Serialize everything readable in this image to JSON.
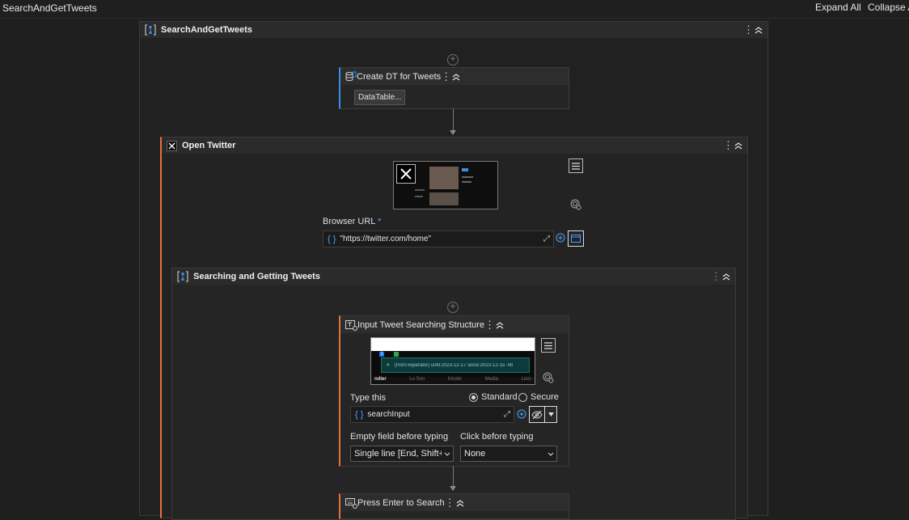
{
  "window": {
    "title": "SearchAndGetTweets"
  },
  "toolbar": {
    "expand_all": "Expand All",
    "collapse_all": "Collapse All"
  },
  "colors": {
    "accent_orange": "#e8703a",
    "accent_blue": "#3a8ee6",
    "background": "#1f1f1f"
  },
  "root": {
    "title": "SearchAndGetTweets",
    "icon": "sequence-icon"
  },
  "create_dt": {
    "title": "Create DT for Tweets",
    "icon": "database-icon",
    "button": "DataTable..."
  },
  "open_twitter": {
    "title": "Open Twitter",
    "icon": "x-logo-icon",
    "url_label": "Browser URL",
    "required_mark": "*",
    "url_value": "\"https://twitter.com/home\""
  },
  "searching": {
    "title": "Searching and Getting Tweets",
    "icon": "sequence-icon"
  },
  "input_tweet": {
    "title": "Input Tweet Searching Structure",
    "icon": "type-into-icon",
    "preview_text": "(from:#operator) until:2023-12-17 since:2023-12-15 -filt",
    "preview_tabs": [
      "ndler",
      "Lo Son",
      "Kinder",
      "Media",
      "Lists"
    ],
    "type_this_label": "Type this",
    "standard_label": "Standard",
    "secure_label": "Secure",
    "type_this_value": "searchInput",
    "empty_field_label": "Empty field before typing",
    "empty_field_value": "Single line [End, Shift+Home, Delete]",
    "click_before_label": "Click before typing",
    "click_before_value": "None"
  },
  "press_enter": {
    "title": "Press Enter to Search",
    "icon": "keyboard-icon"
  }
}
